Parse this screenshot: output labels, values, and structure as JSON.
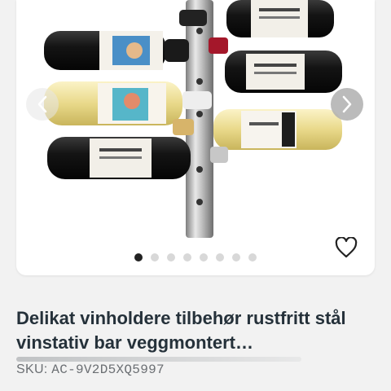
{
  "product": {
    "title": "Delikat vinholdere tilbehør rustfritt stål vinstativ bar veggmontert…",
    "sku_label": "SKU: ",
    "sku_value": "AC-9V2D5XQ5997"
  },
  "gallery": {
    "total_images": 8,
    "active_index": 0
  },
  "colors": {
    "title": "#25313a",
    "sku": "#6b6f73",
    "active_dot": "#222222",
    "inactive_dot": "#d8d8d8"
  },
  "icons": {
    "prev": "chevron-left-icon",
    "next": "chevron-right-icon",
    "favorite": "heart-outline-icon"
  }
}
